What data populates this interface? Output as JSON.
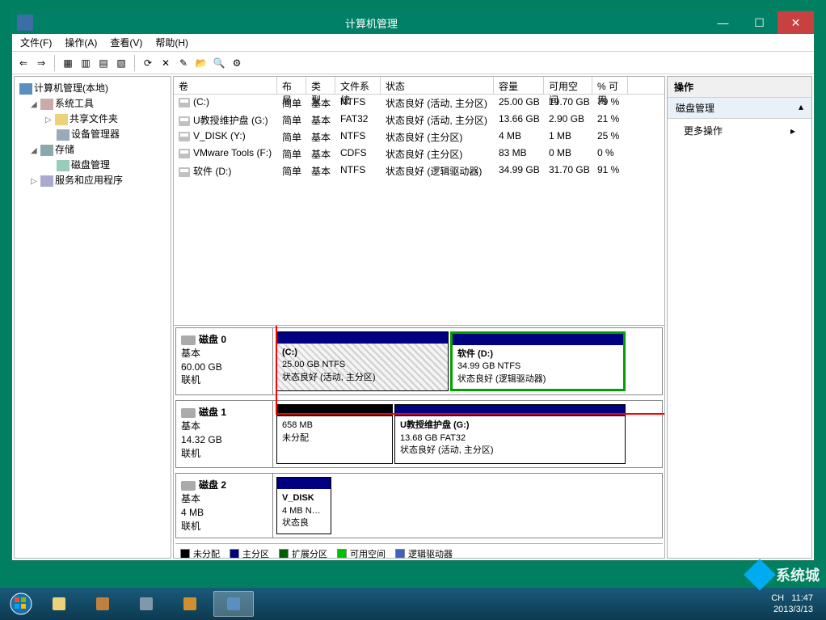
{
  "window": {
    "title": "计算机管理",
    "menu": [
      "文件(F)",
      "操作(A)",
      "查看(V)",
      "帮助(H)"
    ]
  },
  "tree": {
    "root": "计算机管理(本地)",
    "system_tools": "系统工具",
    "shared_folders": "共享文件夹",
    "device_manager": "设备管理器",
    "storage": "存储",
    "disk_mgmt": "磁盘管理",
    "services": "服务和应用程序"
  },
  "vol_headers": {
    "vol": "卷",
    "layout": "布局",
    "type": "类型",
    "fs": "文件系统",
    "status": "状态",
    "cap": "容量",
    "free": "可用空间",
    "pct": "% 可用"
  },
  "volumes": [
    {
      "name": "(C:)",
      "layout": "简单",
      "type": "基本",
      "fs": "NTFS",
      "status": "状态良好 (活动, 主分区)",
      "cap": "25.00 GB",
      "free": "19.70 GB",
      "pct": "79 %"
    },
    {
      "name": "U教授维护盘 (G:)",
      "layout": "简单",
      "type": "基本",
      "fs": "FAT32",
      "status": "状态良好 (活动, 主分区)",
      "cap": "13.66 GB",
      "free": "2.90 GB",
      "pct": "21 %"
    },
    {
      "name": "V_DISK (Y:)",
      "layout": "简单",
      "type": "基本",
      "fs": "NTFS",
      "status": "状态良好 (主分区)",
      "cap": "4 MB",
      "free": "1 MB",
      "pct": "25 %"
    },
    {
      "name": "VMware Tools (F:)",
      "layout": "简单",
      "type": "基本",
      "fs": "CDFS",
      "status": "状态良好 (主分区)",
      "cap": "83 MB",
      "free": "0 MB",
      "pct": "0 %"
    },
    {
      "name": "软件 (D:)",
      "layout": "简单",
      "type": "基本",
      "fs": "NTFS",
      "status": "状态良好 (逻辑驱动器)",
      "cap": "34.99 GB",
      "free": "31.70 GB",
      "pct": "91 %"
    }
  ],
  "disks": [
    {
      "name": "磁盘 0",
      "type": "基本",
      "size": "60.00 GB",
      "status": "联机",
      "parts": [
        {
          "title": "(C:)",
          "line1": "25.00 GB NTFS",
          "line2": "状态良好 (活动, 主分区)",
          "hatch": true,
          "flex": 5
        },
        {
          "title": "软件  (D:)",
          "line1": "34.99 GB NTFS",
          "line2": "状态良好 (逻辑驱动器)",
          "hatch": false,
          "flex": 5,
          "green": true
        }
      ]
    },
    {
      "name": "磁盘 1",
      "type": "基本",
      "size": "14.32 GB",
      "status": "联机",
      "parts": [
        {
          "title": "",
          "line1": "658 MB",
          "line2": "未分配",
          "unalloc": true,
          "flex": 3
        },
        {
          "title": "U教授维护盘   (G:)",
          "line1": "13.68 GB FAT32",
          "line2": "状态良好 (活动, 主分区)",
          "flex": 6
        }
      ]
    },
    {
      "name": "磁盘 2",
      "type": "基本",
      "size": "4 MB",
      "status": "联机",
      "parts": [
        {
          "title": "V_DISK",
          "line1": "4 MB N…",
          "line2": "状态良",
          "flex": 1,
          "narrow": true
        }
      ],
      "short": true
    }
  ],
  "legend": {
    "unalloc": "未分配",
    "primary": "主分区",
    "extended": "扩展分区",
    "free": "可用空间",
    "logical": "逻辑驱动器"
  },
  "actions": {
    "header": "操作",
    "section": "磁盘管理",
    "more": "更多操作"
  },
  "tray": {
    "lang": "CH",
    "time": "11:47",
    "date": "2013/3/13"
  },
  "watermark": "系统城"
}
